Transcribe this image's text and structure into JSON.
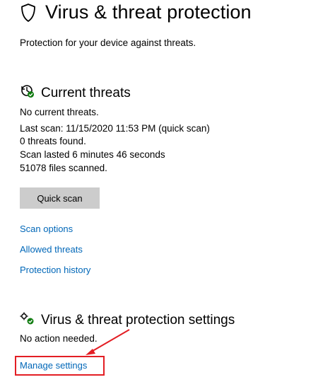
{
  "page": {
    "title": "Virus & threat protection",
    "subtitle": "Protection for your device against threats."
  },
  "current_threats": {
    "heading": "Current threats",
    "status": "No current threats.",
    "last_scan": "Last scan: 11/15/2020 11:53 PM (quick scan)",
    "threats_found": "0 threats found.",
    "scan_duration": "Scan lasted 6 minutes 46 seconds",
    "files_scanned": "51078 files scanned.",
    "quick_scan_label": "Quick scan",
    "links": {
      "scan_options": "Scan options",
      "allowed_threats": "Allowed threats",
      "protection_history": "Protection history"
    }
  },
  "settings_section": {
    "heading": "Virus & threat protection settings",
    "status": "No action needed.",
    "manage_link": "Manage settings"
  },
  "colors": {
    "link": "#0067b8",
    "button_bg": "#cccccc",
    "annotation_red": "#e31e24",
    "icon_green": "#107c10"
  },
  "icons": {
    "title_icon": "shield-icon",
    "threats_icon": "threat-scan-icon",
    "settings_icon": "settings-gears-icon"
  }
}
